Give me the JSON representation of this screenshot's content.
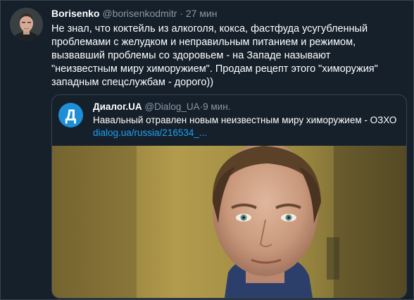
{
  "tweet": {
    "author_name": "Borisenko",
    "author_handle": "@borisenkodmitr",
    "separator": "·",
    "time": "27 мин",
    "text_lines": [
      "Не знал, что коктейль из алкоголя, кокса, фастфуда усугубленный",
      "проблемами с желудком и неправильным питанием и режимом,",
      "вызвавший проблемы со здоровьем - на Западе называют",
      "\"неизвестным миру химоружием\". Продам рецепт этого \"химоружия\"",
      "западным спецслужбам - дорого))"
    ]
  },
  "quoted": {
    "avatar_letter": "Д",
    "author_name": "Диалог.UA",
    "author_handle": "@Dialog_UA",
    "separator": "·",
    "time": "9 мин.",
    "text": "Навальный отравлен новым неизвестным миру химоружием - ОЗХО",
    "link": "dialog.ua/russia/216534_...",
    "colors": {
      "avatar_bg": "#1e8fd6",
      "link": "#1da1f2"
    }
  },
  "colors": {
    "background": "#15202b",
    "border": "#38444d",
    "muted_text": "#8899a6"
  }
}
